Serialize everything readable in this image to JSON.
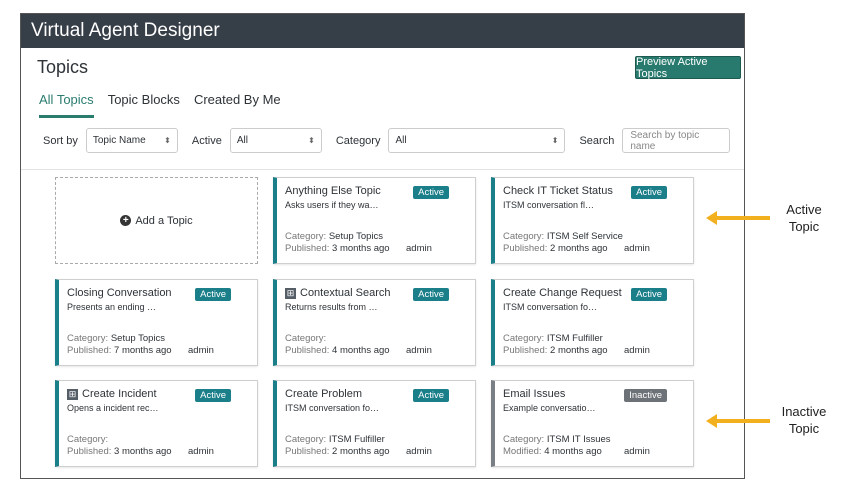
{
  "app": {
    "title": "Virtual Agent Designer"
  },
  "page": {
    "title": "Topics",
    "preview_button": "Preview Active Topics"
  },
  "tabs": [
    {
      "label": "All Topics",
      "active": true
    },
    {
      "label": "Topic Blocks"
    },
    {
      "label": "Created By Me"
    }
  ],
  "filters": {
    "sort_label": "Sort by",
    "sort_value": "Topic Name",
    "active_label": "Active",
    "active_value": "All",
    "category_label": "Category",
    "category_value": "All",
    "search_label": "Search",
    "search_placeholder": "Search by topic name"
  },
  "add_topic": "Add a Topic",
  "cards": [
    {
      "name": "Anything Else Topic",
      "desc": "Asks users if they wa…",
      "status": "Active",
      "cat_label": "Category:",
      "category": "Setup Topics",
      "date_label": "Published:",
      "date": "3 months ago",
      "author": "admin"
    },
    {
      "name": "Check IT Ticket Status",
      "desc": "ITSM conversation fl…",
      "status": "Active",
      "cat_label": "Category:",
      "category": "ITSM Self Service",
      "date_label": "Published:",
      "date": "2 months ago",
      "author": "admin"
    },
    {
      "name": "Closing Conversation",
      "desc": "Presents an ending …",
      "status": "Active",
      "cat_label": "Category:",
      "category": "Setup Topics",
      "date_label": "Published:",
      "date": "7 months ago",
      "author": "admin"
    },
    {
      "name": "Contextual Search",
      "desc": "Returns results from …",
      "status": "Active",
      "cat_label": "Category:",
      "category": "",
      "date_label": "Published:",
      "date": "4 months ago",
      "author": "admin",
      "icon": "grid-icon"
    },
    {
      "name": "Create Change Request",
      "desc": "ITSM conversation fo…",
      "status": "Active",
      "cat_label": "Category:",
      "category": "ITSM Fulfiller",
      "date_label": "Published:",
      "date": "2 months ago",
      "author": "admin"
    },
    {
      "name": "Create Incident",
      "desc": "Opens a incident rec…",
      "status": "Active",
      "cat_label": "Category:",
      "category": "",
      "date_label": "Published:",
      "date": "3 months ago",
      "author": "admin",
      "icon": "grid-icon"
    },
    {
      "name": "Create Problem",
      "desc": "ITSM conversation fo…",
      "status": "Active",
      "cat_label": "Category:",
      "category": "ITSM Fulfiller",
      "date_label": "Published:",
      "date": "2 months ago",
      "author": "admin"
    },
    {
      "name": "Email Issues",
      "desc": "Example conversatio…",
      "status": "Inactive",
      "cat_label": "Category:",
      "category": "ITSM IT Issues",
      "date_label": "Modified:",
      "date": "4 months ago",
      "author": "admin"
    }
  ],
  "annotations": {
    "active": "Active Topic",
    "inactive": "Inactive Topic"
  },
  "colors": {
    "header": "#363e48",
    "accent": "#277a6d",
    "active": "#1b7f8a",
    "inactive": "#6d7278",
    "arrow": "#f2b01e"
  }
}
